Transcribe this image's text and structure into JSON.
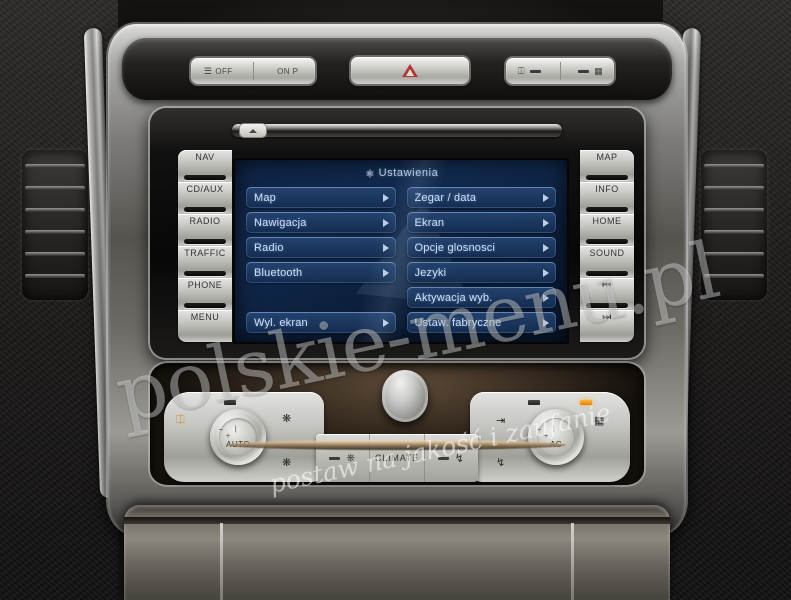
{
  "screen": {
    "title": "Ustawienia",
    "title_icon": "gear-icon",
    "menu_left": [
      {
        "label": "Map",
        "arrow": true
      },
      {
        "label": "Nawigacja",
        "arrow": true
      },
      {
        "label": "Radio",
        "arrow": true
      },
      {
        "label": "Bluetooth",
        "arrow": true
      },
      {
        "label": "",
        "arrow": false
      },
      {
        "label": "Wyl. ekran",
        "arrow": true
      }
    ],
    "menu_right": [
      {
        "label": "Zegar / data",
        "arrow": true
      },
      {
        "label": "Ekran",
        "arrow": true
      },
      {
        "label": "Opcje glosnosci",
        "arrow": true
      },
      {
        "label": "Jezyki",
        "arrow": true
      },
      {
        "label": "Aktywacja wyb.",
        "arrow": true
      },
      {
        "label": "Ustaw. fabryczne",
        "arrow": true
      }
    ],
    "colors": {
      "background": "#0e2344",
      "item": "#244470",
      "text": "#cfe0f3"
    }
  },
  "buttons_left": [
    {
      "label": "NAV"
    },
    {
      "label": "CD/AUX"
    },
    {
      "label": "RADIO"
    },
    {
      "label": "TRAFFIC"
    },
    {
      "label": "PHONE"
    },
    {
      "label": "MENU"
    }
  ],
  "buttons_right": [
    {
      "label": "MAP"
    },
    {
      "label": "INFO"
    },
    {
      "label": "HOME"
    },
    {
      "label": "SOUND"
    },
    {
      "label": "⏮"
    },
    {
      "label": "⏭"
    }
  ],
  "top_switches": {
    "park_assist": {
      "off_label": "OFF",
      "on_label": "ON P",
      "icon": "park-sensor-icon"
    },
    "hazard": {
      "icon": "hazard-triangle-icon",
      "color": "#b0352f"
    },
    "defrost": {
      "front_icon": "windscreen-heater-icon",
      "rear_icon": "rear-window-defrost-icon"
    }
  },
  "cd": {
    "eject_icon": "eject-icon"
  },
  "climate": {
    "left_knob": {
      "label": "AUTO",
      "minus": "–",
      "plus": "+"
    },
    "right_knob": {
      "label": "AC",
      "minus": "–",
      "plus": "+"
    },
    "center_label": "CLIMATE",
    "icons": {
      "heated_windscreen": "heated-windscreen-icon",
      "fan_up": "fan-increase-icon",
      "fan_down": "fan-decrease-icon",
      "recirculation": "air-recirculation-icon",
      "airflow_face": "airflow-face-icon",
      "airflow_feet": "airflow-feet-icon",
      "heated_rear": "heated-rear-window-icon"
    }
  },
  "watermark": {
    "main": "polskie-menu.pl",
    "sub": "postaw na jakość i zaufanie"
  }
}
